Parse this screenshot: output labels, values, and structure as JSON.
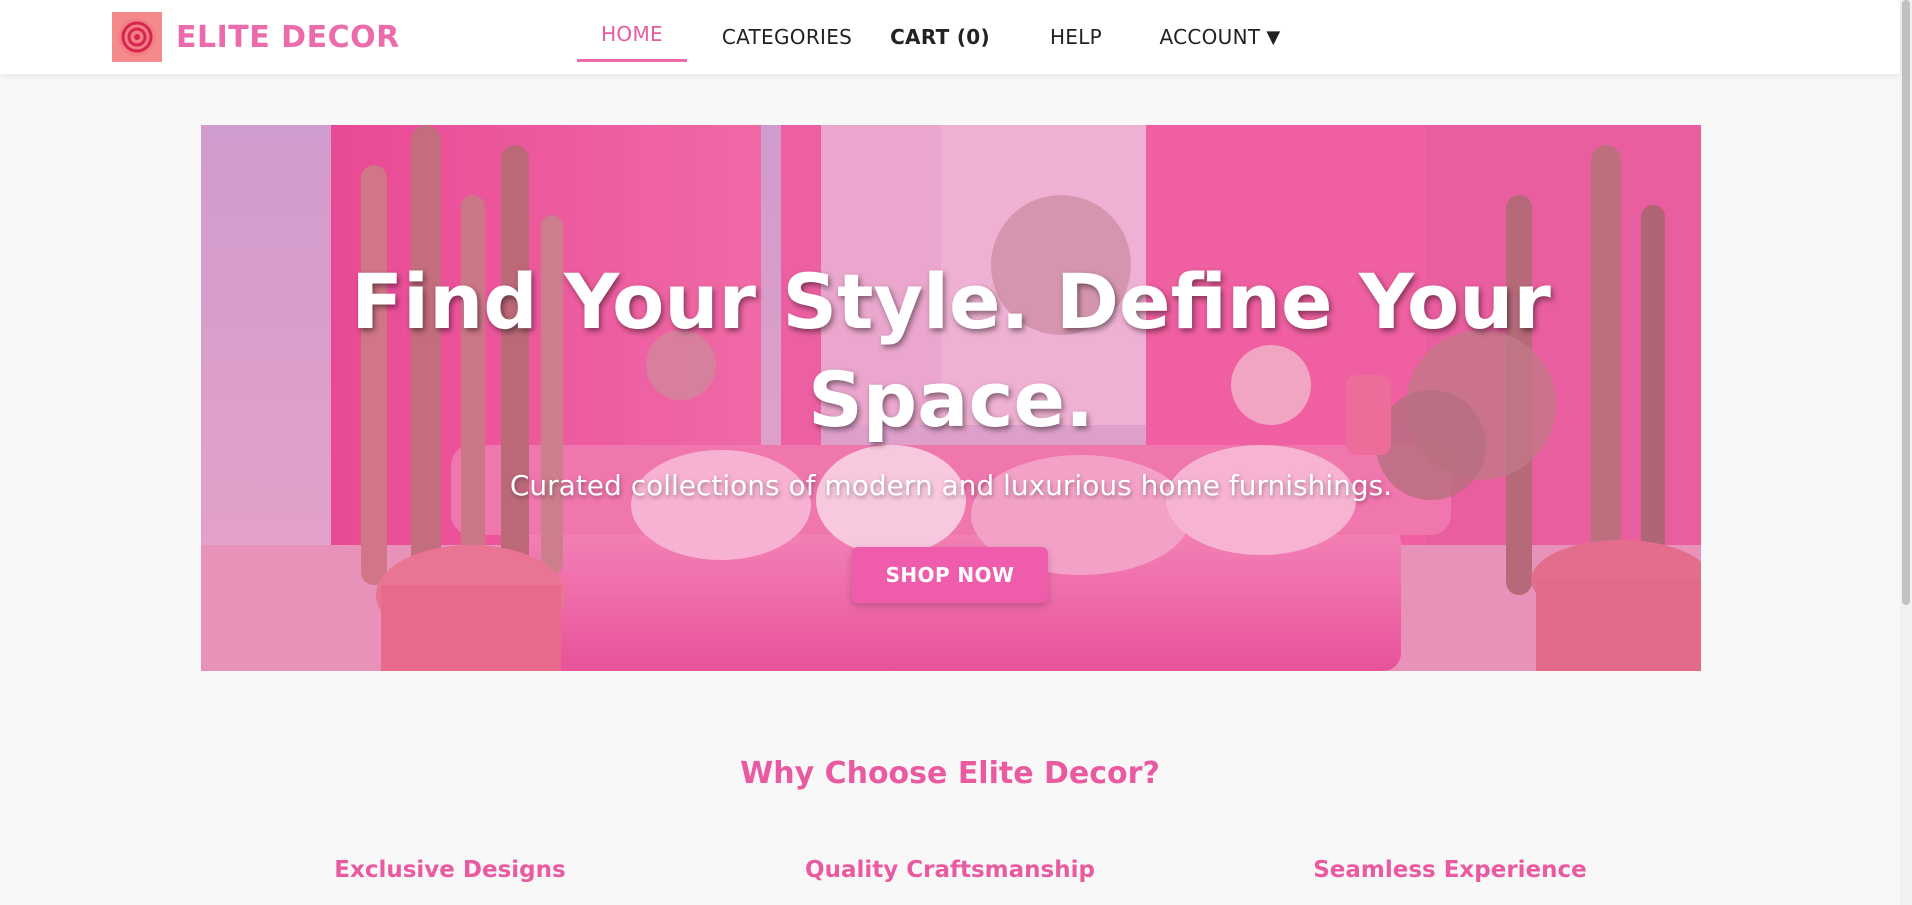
{
  "brand": {
    "name": "ELITE DECOR",
    "logo_icon": "spiral-icon",
    "accent_color": "#ec6bab",
    "logo_bg_color": "#f58a8a"
  },
  "nav": {
    "items": [
      {
        "label": "HOME",
        "active": true
      },
      {
        "label": "CATEGORIES",
        "active": false
      },
      {
        "label": "CART (0)",
        "active": false
      },
      {
        "label": "HELP",
        "active": false
      },
      {
        "label": "ACCOUNT",
        "active": false,
        "icon": "caret-down-icon"
      }
    ],
    "account_arrow": "▼"
  },
  "hero": {
    "title": "Find Your Style. Define Your Space.",
    "subtitle": "Curated collections of modern and luxurious home furnishings.",
    "cta_label": "SHOP NOW",
    "cta_color": "#ef5cab"
  },
  "why": {
    "title": "Why Choose Elite Decor?",
    "features": [
      {
        "title": "Exclusive Designs"
      },
      {
        "title": "Quality Craftsmanship"
      },
      {
        "title": "Seamless Experience"
      }
    ]
  }
}
